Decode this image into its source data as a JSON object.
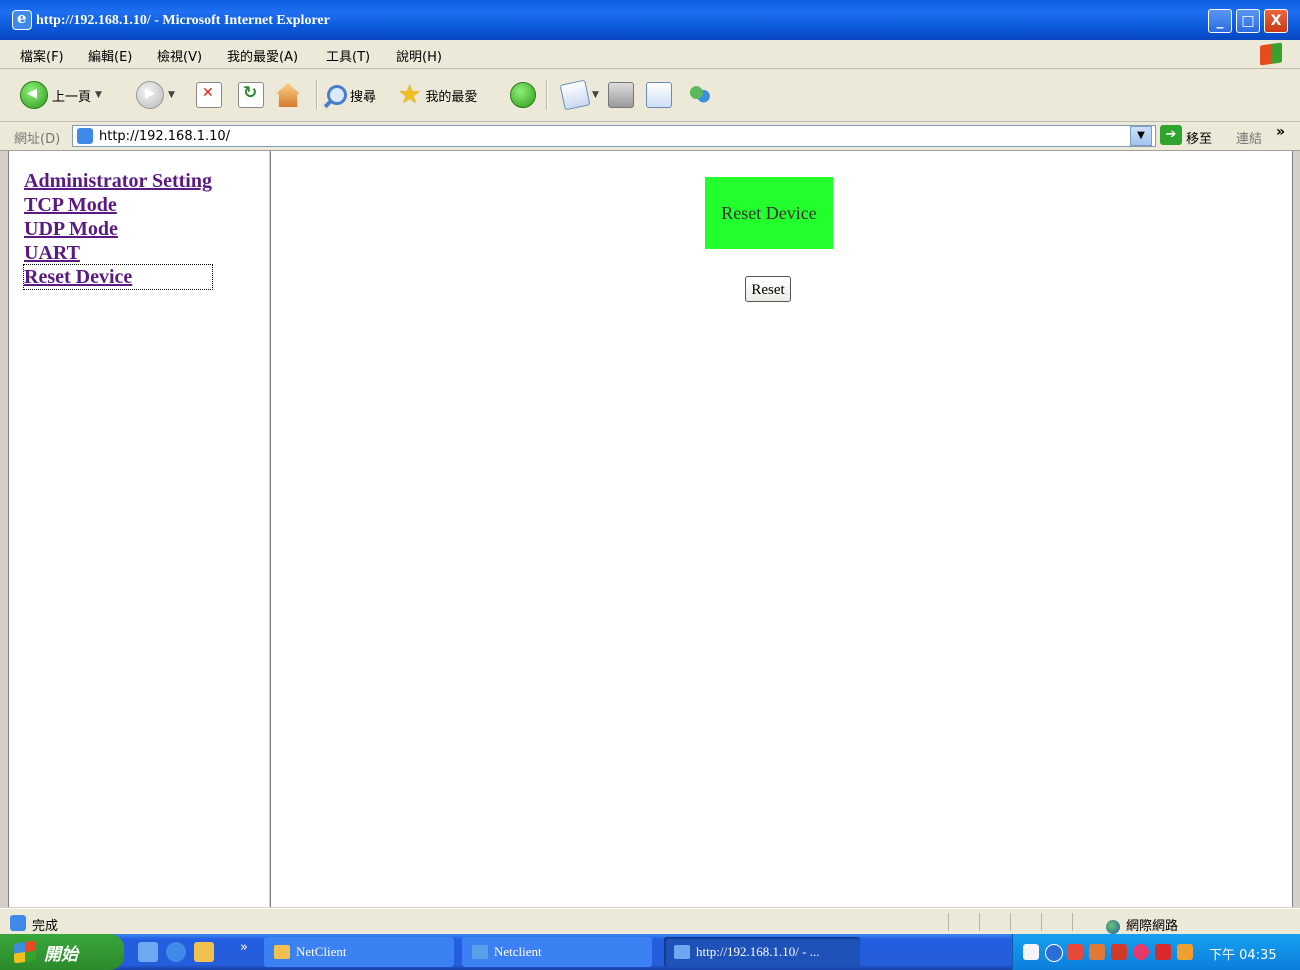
{
  "window": {
    "title": "http://192.168.1.10/ - Microsoft Internet Explorer",
    "controls": {
      "minimize": "_",
      "maximize": "□",
      "close": "X"
    }
  },
  "menu": [
    "檔案(F)",
    "編輯(E)",
    "檢視(V)",
    "我的最愛(A)",
    "工具(T)",
    "說明(H)"
  ],
  "toolbar": {
    "back_label": "上一頁",
    "search_label": "搜尋",
    "favorites_label": "我的最愛"
  },
  "address": {
    "label": "網址(D)",
    "url": "http://192.168.1.10/",
    "go_label": "移至",
    "links_label": "連結",
    "more_label": "»"
  },
  "nav": {
    "items": [
      "Administrator Setting",
      "TCP Mode",
      "UDP Mode",
      "UART",
      "Reset Device"
    ],
    "focused_index": 4
  },
  "main": {
    "heading": "Reset Device",
    "heading_color": "#22ff2c",
    "button_label": "Reset"
  },
  "status": {
    "text": "完成",
    "zone": "網際網路"
  },
  "taskbar": {
    "start_label": "開始",
    "overflow": "»",
    "buttons": [
      "NetClient",
      "Netclient",
      "http://192.168.1.10/ - ..."
    ],
    "clock": "下午 04:35"
  },
  "icons": [
    "ie-icon",
    "back-icon",
    "forward-icon",
    "stop-icon",
    "refresh-icon",
    "home-icon",
    "search-icon",
    "favorites-icon",
    "history-icon",
    "mail-icon",
    "print-icon",
    "edit-icon",
    "messenger-icon",
    "globe-icon",
    "windows-flag-icon"
  ]
}
